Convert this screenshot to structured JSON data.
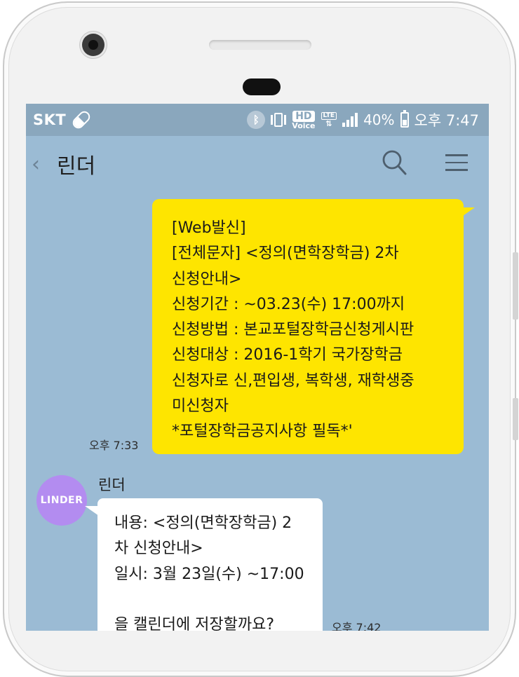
{
  "status_bar": {
    "carrier": "SKT",
    "hd_label": "HD",
    "voice_label": "Voice",
    "lte_label": "LTE",
    "battery_percent": "40%",
    "time": "오후 7:47"
  },
  "chat": {
    "title": "린더"
  },
  "messages": [
    {
      "direction": "sent",
      "lines": [
        "[Web발신]",
        "[전체문자] <정의(면학장학금) 2차",
        "신청안내>",
        "신청기간 : ~03.23(수) 17:00까지",
        "신청방법 : 본교포털장학금신청게시판",
        "신청대상 : 2016-1학기 국가장학금",
        "신청자로 신,편입생, 복학생, 재학생중",
        "미신청자",
        "*포털장학금공지사항 필독*'"
      ],
      "time": "오후 7:33"
    },
    {
      "direction": "received",
      "sender": "린더",
      "avatar_text": "LINDER",
      "lines": [
        "내용: <정의(면학장학금) 2",
        "차 신청안내>",
        "일시: 3월 23일(수) ~17:00",
        "",
        "을 캘린더에 저장할까요?"
      ],
      "time": "오후 7:42"
    }
  ],
  "colors": {
    "screen_bg": "#9bbbd4",
    "status_bar_bg": "#8aa7bd",
    "sent_bubble": "#fee500",
    "received_bubble": "#ffffff",
    "avatar_bg": "#b38cf0"
  }
}
